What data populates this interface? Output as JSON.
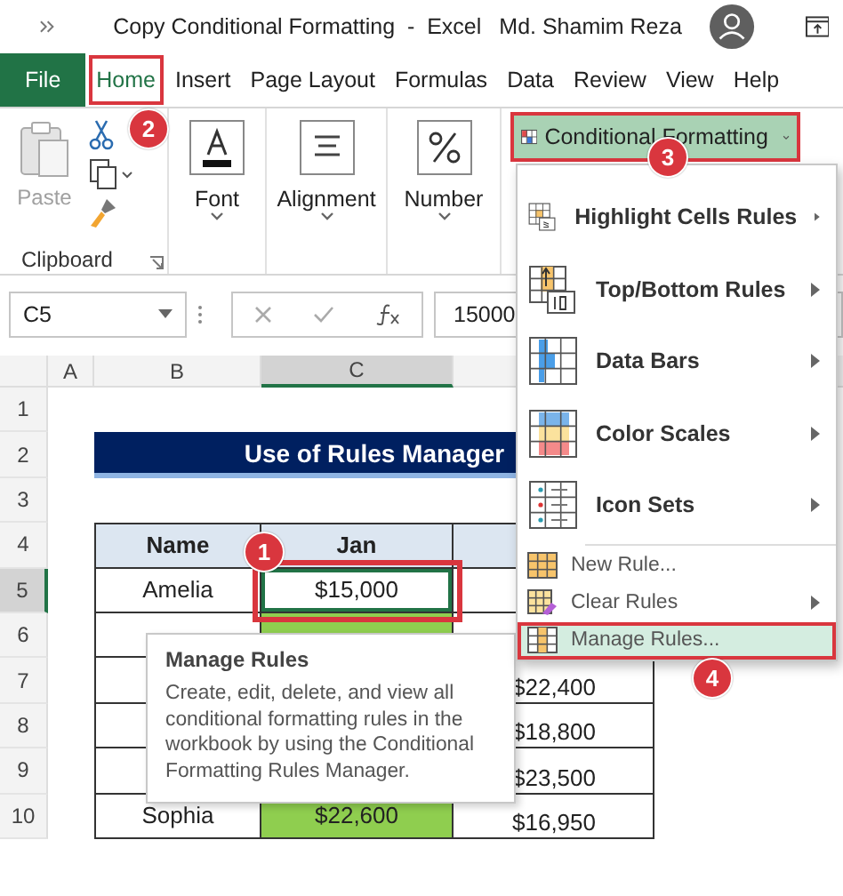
{
  "window": {
    "title": "Copy Conditional Formatting  -  Excel",
    "user": "Md. Shamim Reza"
  },
  "ribbon_tabs": [
    {
      "label": "File",
      "kind": "file",
      "selected": false,
      "annotated": false
    },
    {
      "label": "Home",
      "kind": "tab",
      "selected": true,
      "annotated": true
    },
    {
      "label": "Insert",
      "kind": "tab",
      "selected": false,
      "annotated": false
    },
    {
      "label": "Page Layout",
      "kind": "tab",
      "selected": false,
      "annotated": false
    },
    {
      "label": "Formulas",
      "kind": "tab",
      "selected": false,
      "annotated": false
    },
    {
      "label": "Data",
      "kind": "tab",
      "selected": false,
      "annotated": false
    },
    {
      "label": "Review",
      "kind": "tab",
      "selected": false,
      "annotated": false
    },
    {
      "label": "View",
      "kind": "tab",
      "selected": false,
      "annotated": false
    },
    {
      "label": "Help",
      "kind": "tab",
      "selected": false,
      "annotated": false
    }
  ],
  "clipboard": {
    "paste_label": "Paste",
    "paste_disabled": true,
    "group_label": "Clipboard"
  },
  "ribbon_buttons": [
    {
      "label": "Font",
      "kind": "font"
    },
    {
      "label": "Alignment",
      "kind": "alignment"
    },
    {
      "label": "Number",
      "kind": "number"
    }
  ],
  "conditional_formatting_button": {
    "label": "Conditional Formatting",
    "annotated": true
  },
  "formula_bar": {
    "name_box": "C5",
    "value": "15000"
  },
  "column_headers": [
    {
      "label": "A",
      "selected": false
    },
    {
      "label": "B",
      "selected": false
    },
    {
      "label": "C",
      "selected": true
    }
  ],
  "row_headers": [
    {
      "label": "1",
      "selected": false
    },
    {
      "label": "2",
      "selected": false
    },
    {
      "label": "3",
      "selected": false
    },
    {
      "label": "4",
      "selected": false
    },
    {
      "label": "5",
      "selected": true
    },
    {
      "label": "6",
      "selected": false
    },
    {
      "label": "7",
      "selected": false
    },
    {
      "label": "8",
      "selected": false
    },
    {
      "label": "9",
      "selected": false
    },
    {
      "label": "10",
      "selected": false
    }
  ],
  "sheet": {
    "title": "Use of Rules Manager",
    "table_columns": [
      "Name",
      "Jan"
    ],
    "rows": [
      {
        "name": "Amelia",
        "jan": "$15,000",
        "jan_highlight": false,
        "selected": true,
        "annotated": true
      },
      {
        "jan_highlight": true,
        "selected": false,
        "annotated": false
      },
      {
        "column_3": "$22,400"
      },
      {
        "column_3": "$18,800"
      },
      {
        "column_3": "$23,500"
      },
      {
        "name": "Sophia",
        "jan": "$22,600",
        "jan_highlight": true,
        "selected": false,
        "annotated": false,
        "column_3": "$16,950"
      }
    ]
  },
  "menu": {
    "items": [
      {
        "label": "Highlight Cells Rules",
        "kind": "highlight",
        "submenu": true,
        "selected": false,
        "annotated": false
      },
      {
        "label": "Top/Bottom Rules",
        "kind": "topbottom",
        "submenu": true,
        "selected": false,
        "annotated": false
      },
      {
        "label": "Data Bars",
        "kind": "databars",
        "submenu": true,
        "selected": false,
        "annotated": false
      },
      {
        "label": "Color Scales",
        "kind": "colorscales",
        "submenu": true,
        "selected": false,
        "annotated": false
      },
      {
        "label": "Icon Sets",
        "kind": "iconsets",
        "submenu": true,
        "selected": false,
        "annotated": false
      },
      {
        "label": "New Rule...",
        "kind": "newrule",
        "submenu": false,
        "selected": false,
        "annotated": false
      },
      {
        "label": "Clear Rules",
        "kind": "clearrules",
        "submenu": true,
        "selected": false,
        "annotated": false
      },
      {
        "label": "Manage Rules...",
        "kind": "managerules",
        "submenu": false,
        "selected": true,
        "annotated": true
      }
    ]
  },
  "tooltip": {
    "title": "Manage Rules",
    "text": "Create, edit, delete, and view all conditional formatting rules in the workbook by using the Conditional Formatting Rules Manager."
  },
  "callouts": [
    {
      "label": "1"
    },
    {
      "label": "2"
    },
    {
      "label": "3"
    },
    {
      "label": "4"
    }
  ]
}
